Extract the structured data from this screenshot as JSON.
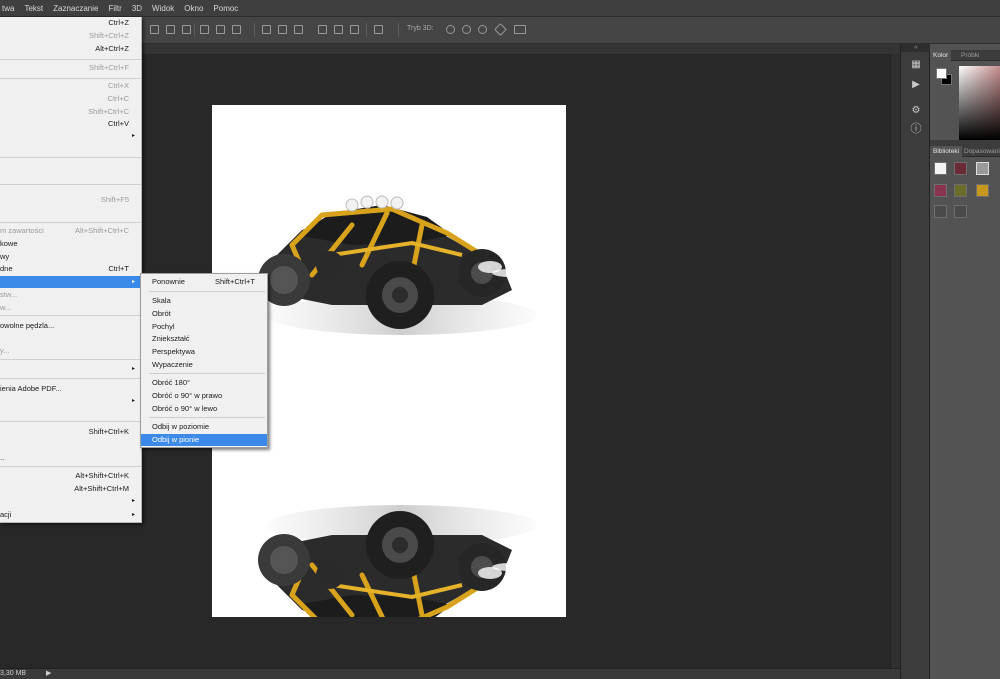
{
  "menubar": {
    "items": [
      "twa",
      "Tekst",
      "Zaznaczanie",
      "Filtr",
      "3D",
      "Widok",
      "Okno",
      "Pomoc"
    ]
  },
  "optionsbar": {
    "mode_3d_label": "Tryb 3D:"
  },
  "status": {
    "doc_size": "3,30 MB",
    "arrow": "▶"
  },
  "panels": {
    "collapse_glyph": "«",
    "color_tabs": [
      "Kolor",
      "Próbki"
    ],
    "library_tabs": [
      "Biblioteki",
      "Dopasowania"
    ],
    "foreground_color": "#ffffff",
    "background_color": "#000000"
  },
  "edit_menu": {
    "rows": [
      {
        "label": "",
        "shortcut": "Ctrl+Z",
        "disabled": false
      },
      {
        "label": "",
        "shortcut": "Shift+Ctrl+Z",
        "disabled": true
      },
      {
        "label": "",
        "shortcut": "Alt+Ctrl+Z",
        "disabled": false
      },
      {
        "label": "",
        "shortcut": "Shift+Ctrl+F",
        "disabled": true
      },
      {
        "label": "",
        "shortcut": "Ctrl+X",
        "disabled": true
      },
      {
        "label": "",
        "shortcut": "Ctrl+C",
        "disabled": true
      },
      {
        "label": "",
        "shortcut": "Shift+Ctrl+C",
        "disabled": true
      },
      {
        "label": "",
        "shortcut": "Ctrl+V",
        "disabled": false
      },
      {
        "label": "",
        "shortcut": "Shift+F5",
        "disabled": true
      },
      {
        "label": "m zawartości",
        "shortcut": "Alt+Shift+Ctrl+C",
        "disabled": true
      },
      {
        "label": "kowe",
        "shortcut": "",
        "disabled": false
      },
      {
        "label": "wy",
        "shortcut": "",
        "disabled": false
      },
      {
        "label": "dne",
        "shortcut": "Ctrl+T",
        "disabled": false
      },
      {
        "label": "stw...",
        "shortcut": "",
        "disabled": true
      },
      {
        "label": "w...",
        "shortcut": "",
        "disabled": true
      },
      {
        "label": "owolne pędzla...",
        "shortcut": "",
        "disabled": false
      },
      {
        "label": "y...",
        "shortcut": "",
        "disabled": true
      },
      {
        "label": "ienia Adobe PDF...",
        "shortcut": "",
        "disabled": false
      },
      {
        "label": "",
        "shortcut": "Shift+Ctrl+K",
        "disabled": false
      },
      {
        "label": "..",
        "shortcut": "",
        "disabled": false
      },
      {
        "label": "",
        "shortcut": "Alt+Shift+Ctrl+K",
        "disabled": false
      },
      {
        "label": "",
        "shortcut": "Alt+Shift+Ctrl+M",
        "disabled": false
      },
      {
        "label": "acji",
        "shortcut": "",
        "disabled": false
      }
    ],
    "arrow_glyph": "▸"
  },
  "transform_submenu": {
    "items": [
      {
        "label": "Ponownie",
        "shortcut": "Shift+Ctrl+T"
      },
      {
        "label": "Skala",
        "shortcut": ""
      },
      {
        "label": "Obrót",
        "shortcut": ""
      },
      {
        "label": "Pochyl",
        "shortcut": ""
      },
      {
        "label": "Zniekształć",
        "shortcut": ""
      },
      {
        "label": "Perspektywa",
        "shortcut": ""
      },
      {
        "label": "Wypaczenie",
        "shortcut": ""
      },
      {
        "label": "Obróć 180°",
        "shortcut": ""
      },
      {
        "label": "Obróć o 90° w prawo",
        "shortcut": ""
      },
      {
        "label": "Obróć o 90° w lewo",
        "shortcut": ""
      },
      {
        "label": "Odbij w poziomie",
        "shortcut": ""
      },
      {
        "label": "Odbij w pionie",
        "shortcut": "",
        "highlighted": true
      }
    ]
  },
  "accent_color": "#3b8ae8"
}
